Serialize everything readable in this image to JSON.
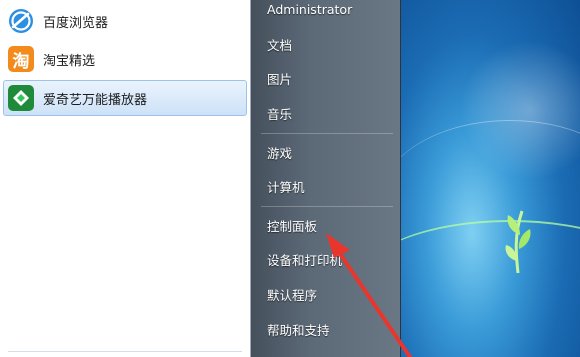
{
  "start_menu": {
    "programs": [
      {
        "label": "百度浏览器",
        "icon": "baidu-browser-icon"
      },
      {
        "label": "淘宝精选",
        "icon": "taobao-icon",
        "icon_text": "淘"
      },
      {
        "label": "爱奇艺万能播放器",
        "icon": "iqiyi-player-icon",
        "selected": true
      }
    ],
    "places": [
      {
        "label": "Administrator"
      },
      {
        "label": "文档"
      },
      {
        "label": "图片"
      },
      {
        "label": "音乐"
      },
      {
        "label": "游戏"
      },
      {
        "label": "计算机"
      },
      {
        "label": "控制面板"
      },
      {
        "label": "设备和打印机"
      },
      {
        "label": "默认程序"
      },
      {
        "label": "帮助和支持"
      }
    ]
  },
  "colors": {
    "annotation_arrow": "#e8362d",
    "selection": "#cde2f8",
    "taobao_orange": "#f28b1c",
    "iqiyi_green": "#34a853"
  }
}
